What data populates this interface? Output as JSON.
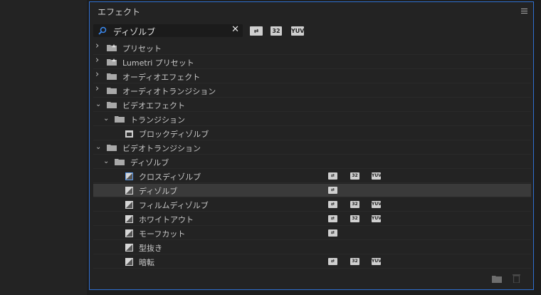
{
  "panel": {
    "title": "エフェクト"
  },
  "search": {
    "value": "ディゾルブ",
    "clear": "✕"
  },
  "filters": [
    {
      "label": "⇄",
      "name": "accelerated-effects-filter"
    },
    {
      "label": "32",
      "name": "32bit-filter"
    },
    {
      "label": "YUV",
      "name": "yuv-filter"
    }
  ],
  "tree": [
    {
      "label": "プリセット",
      "level": 0,
      "kind": "folder-star",
      "expanded": false
    },
    {
      "label": "Lumetri プリセット",
      "level": 0,
      "kind": "folder-star",
      "expanded": false
    },
    {
      "label": "オーディオエフェクト",
      "level": 0,
      "kind": "folder",
      "expanded": false
    },
    {
      "label": "オーディオトランジション",
      "level": 0,
      "kind": "folder",
      "expanded": false
    },
    {
      "label": "ビデオエフェクト",
      "level": 0,
      "kind": "folder",
      "expanded": true
    },
    {
      "label": "トランジション",
      "level": 1,
      "kind": "folder",
      "expanded": true
    },
    {
      "label": "ブロックディゾルブ",
      "level": 2,
      "kind": "effect",
      "badges": []
    },
    {
      "label": "ビデオトランジション",
      "level": 0,
      "kind": "folder",
      "expanded": true
    },
    {
      "label": "ディゾルブ",
      "level": 1,
      "kind": "folder",
      "expanded": true
    },
    {
      "label": "クロスディゾルブ",
      "level": 2,
      "kind": "transition",
      "badges": [
        "accel",
        "32",
        "YUV"
      ],
      "focused": true
    },
    {
      "label": "ディゾルブ",
      "level": 2,
      "kind": "transition",
      "badges": [
        "accel"
      ],
      "selected": true
    },
    {
      "label": "フィルムディゾルブ",
      "level": 2,
      "kind": "transition",
      "badges": [
        "accel",
        "32",
        "YUV"
      ]
    },
    {
      "label": "ホワイトアウト",
      "level": 2,
      "kind": "transition",
      "badges": [
        "accel",
        "32",
        "YUV"
      ]
    },
    {
      "label": "モーフカット",
      "level": 2,
      "kind": "transition",
      "badges": [
        "accel"
      ]
    },
    {
      "label": "型抜き",
      "level": 2,
      "kind": "transition",
      "badges": []
    },
    {
      "label": "暗転",
      "level": 2,
      "kind": "transition",
      "badges": [
        "accel",
        "32",
        "YUV"
      ]
    }
  ],
  "badge_labels": {
    "accel": "⇄",
    "32": "32",
    "YUV": "YUV"
  },
  "colors": {
    "accent": "#2f6fd0",
    "selected_row": "#3a3a3a",
    "badge": "#cfcfcf"
  },
  "icons": [
    "search-icon",
    "clear-icon",
    "panel-menu-icon",
    "new-bin-icon",
    "trash-icon"
  ]
}
